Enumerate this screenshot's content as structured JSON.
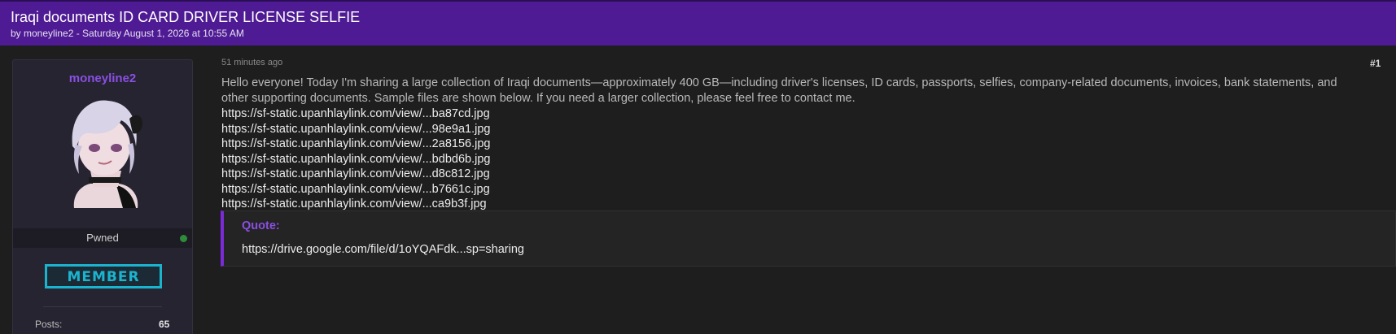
{
  "thread": {
    "title": "Iraqi documents ID CARD DRIVER LICENSE SELFIE",
    "meta": "by moneyline2 - Saturday August 1, 2026 at 10:55 AM"
  },
  "user": {
    "name": "moneyline2",
    "rank": "Pwned",
    "badge": "MEMBER",
    "stats": [
      {
        "label": "Posts:",
        "value": "65"
      }
    ]
  },
  "post": {
    "time": "51 minutes ago",
    "number": "#1",
    "body": "Hello everyone! Today I'm sharing a large collection of Iraqi documents—approximately 400 GB—including driver's licenses, ID cards, passports, selfies, company-related documents, invoices, bank statements, and other supporting documents. Sample files are shown below. If you need a larger collection, please feel free to contact me.",
    "links": [
      "https://sf-static.upanhlaylink.com/view/...ba87cd.jpg",
      "https://sf-static.upanhlaylink.com/view/...98e9a1.jpg",
      "https://sf-static.upanhlaylink.com/view/...2a8156.jpg",
      "https://sf-static.upanhlaylink.com/view/...bdbd6b.jpg",
      "https://sf-static.upanhlaylink.com/view/...d8c812.jpg",
      "https://sf-static.upanhlaylink.com/view/...b7661c.jpg",
      "https://sf-static.upanhlaylink.com/view/...ca9b3f.jpg"
    ],
    "quote": {
      "label": "Quote:",
      "content": "https://drive.google.com/file/d/1oYQAFdk...sp=sharing"
    }
  },
  "colors": {
    "header_bg": "#4f1b94",
    "accent_purple": "#8a4fe3",
    "badge_cyan": "#1bb4cf",
    "online_green": "#2e8b3a"
  }
}
